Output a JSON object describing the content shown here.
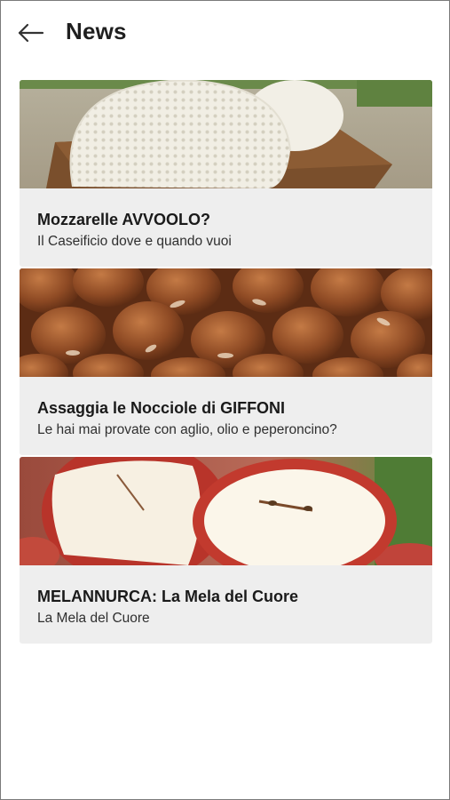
{
  "header": {
    "title": "News",
    "back_icon": "arrow-left-icon"
  },
  "news": [
    {
      "title": "Mozzarelle AVVOOLO?",
      "subtitle": "Il Caseificio dove e quando vuoi",
      "image": "mozzarella-photo"
    },
    {
      "title": "Assaggia le Nocciole di GIFFONI",
      "subtitle": "Le hai mai provate con aglio, olio e peperoncino?",
      "image": "hazelnuts-photo"
    },
    {
      "title": "MELANNURCA: La Mela del Cuore",
      "subtitle": "La Mela del Cuore",
      "image": "apple-photo"
    }
  ],
  "colors": {
    "card_background": "#eeeeee",
    "title_text": "#1a1a1a",
    "subtitle_text": "#2f2f2f"
  }
}
